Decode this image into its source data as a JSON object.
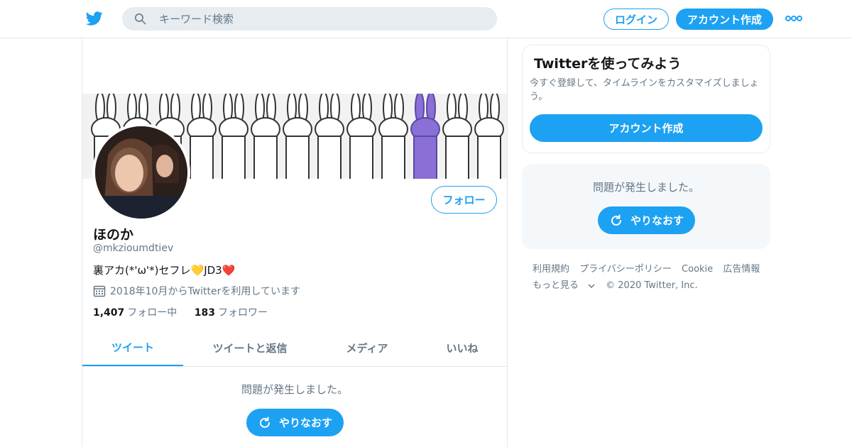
{
  "colors": {
    "accent": "#1da1f2",
    "text": "#14171a",
    "muted": "#657786",
    "border": "#e1e8ed",
    "panel": "#f5f8fa"
  },
  "header": {
    "logo_icon": "twitter-bird-icon",
    "search": {
      "placeholder": "キーワード検索",
      "icon": "search-icon"
    },
    "login_label": "ログイン",
    "signup_label": "アカウント作成",
    "more_icon": "more-dots-icon"
  },
  "profile": {
    "follow_label": "フォロー",
    "display_name": "ほのか",
    "handle": "@mkzioumdtiev",
    "bio": "裏アカ(*'ω'*)セフレ💛JD3❤️",
    "joined": "2018年10月からTwitterを利用しています",
    "following_count": "1,407",
    "following_label": "フォロー中",
    "followers_count": "183",
    "followers_label": "フォロワー"
  },
  "tabs": [
    {
      "label": "ツイート",
      "active": true
    },
    {
      "label": "ツイートと返信",
      "active": false
    },
    {
      "label": "メディア",
      "active": false
    },
    {
      "label": "いいね",
      "active": false
    }
  ],
  "timeline": {
    "error_message": "問題が発生しました。",
    "retry_label": "やりなおす"
  },
  "sidebar": {
    "try_card": {
      "title": "Twitterを使ってみよう",
      "description": "今すぐ登録して、タイムラインをカスタマイズしましょう。",
      "signup_label": "アカウント作成"
    },
    "error_card": {
      "message": "問題が発生しました。",
      "retry_label": "やりなおす"
    },
    "footer": {
      "links": [
        "利用規約",
        "プライバシーポリシー",
        "Cookie",
        "広告情報"
      ],
      "more_label": "もっと見る",
      "copyright": "© 2020 Twitter, Inc."
    }
  }
}
